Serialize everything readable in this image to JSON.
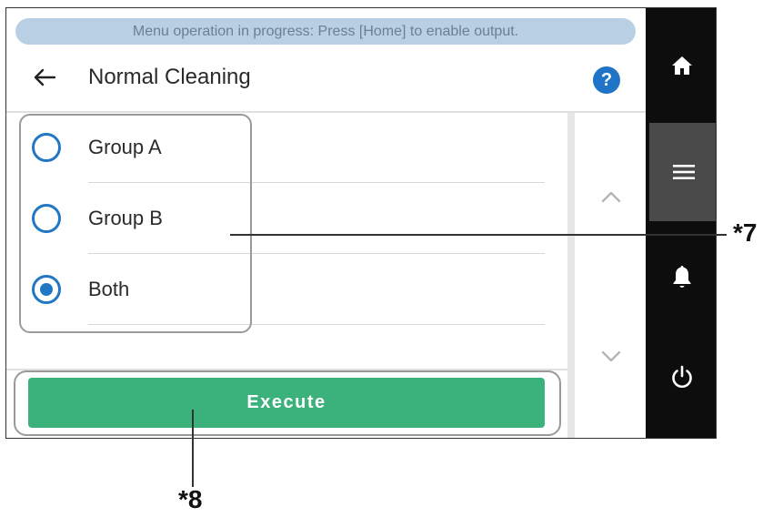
{
  "status_banner": "Menu operation in progress: Press [Home] to enable output.",
  "header": {
    "back_icon": "arrow-left-icon",
    "title": "Normal Cleaning",
    "help_label": "?"
  },
  "options": [
    {
      "label": "Group A",
      "selected": false
    },
    {
      "label": "Group B",
      "selected": false
    },
    {
      "label": "Both",
      "selected": true
    }
  ],
  "execute_label": "Execute",
  "side_rail": {
    "icons": [
      "home-icon",
      "menu-icon",
      "bell-icon",
      "power-icon"
    ]
  },
  "callouts": {
    "options_label": "*7",
    "execute_label": "*8"
  },
  "colors": {
    "accent": "#2277c4",
    "execute": "#3bb17c",
    "banner": "#b9cfe3",
    "rail": "#0d0d0d",
    "rail_active": "#4a4a4a"
  }
}
